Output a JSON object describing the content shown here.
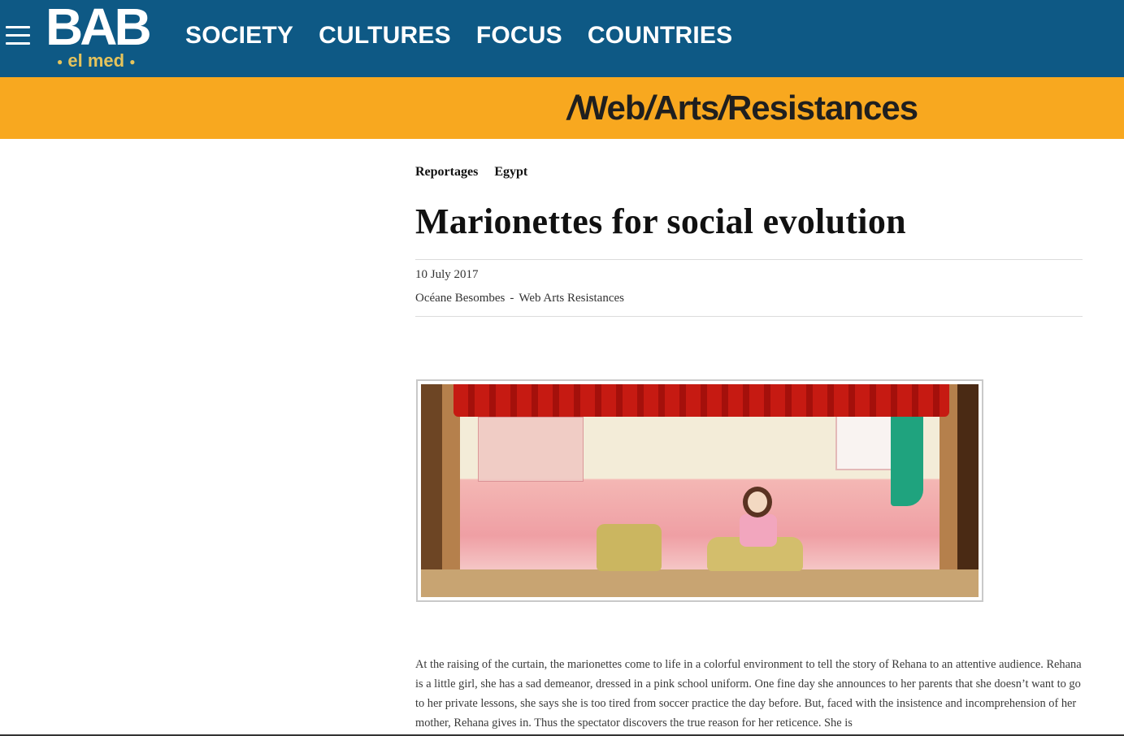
{
  "header": {
    "logo_main": "BAB",
    "logo_sub": "el med",
    "nav_items": [
      "SOCIETY",
      "CULTURES",
      "FOCUS",
      "COUNTRIES"
    ],
    "icons": {
      "menu": "hamburger-menu-icon"
    },
    "colors": {
      "header_bg": "#0e5985",
      "logo_accent": "#e6c45c"
    }
  },
  "banner": {
    "part1": "Web",
    "part2": "Arts",
    "part3": "Resistances",
    "color": "#f8a81f"
  },
  "article": {
    "tags": [
      "Reportages",
      "Egypt"
    ],
    "title": "Marionettes for social evolution",
    "date": "10 July 2017",
    "author": "Océane Besombes",
    "separator": "-",
    "section": "Web Arts Resistances",
    "image_alt": "marionette puppet theatre stage with a doll in a pink room",
    "body": "At the raising of the curtain, the marionettes come to life in a colorful environment to tell the story of Rehana to an attentive audience. Rehana is a little girl, she has a sad demeanor, dressed in a pink school uniform. One fine day she announces to her parents that she doesn’t want to go to her private lessons, she says she is too tired from soccer practice the day before. But, faced with the insistence and incomprehension of her mother, Rehana gives in. Thus the spectator discovers the true reason for her reticence. She is"
  }
}
